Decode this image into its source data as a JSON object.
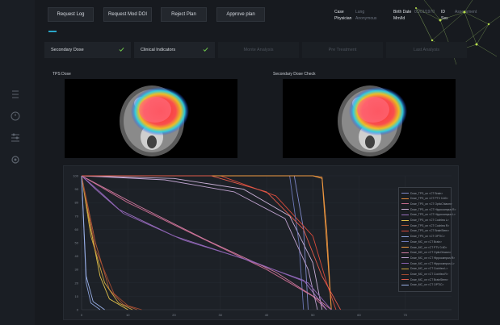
{
  "toolbar": {
    "request_log": "Request Log",
    "request_mod": "Request Mod DOI",
    "reject_plan": "Reject Plan",
    "approve_plan": "Approve plan"
  },
  "patient": {
    "case_label": "Case",
    "case_value": "Lung",
    "physician_label": "Physician",
    "physician_value": "Anonymous",
    "birth_label": "Birth Date",
    "birth_value": "01/01/1970",
    "mrn_label": "Mrn/Id",
    "mrn_value": "ID",
    "sex_label": "Sex",
    "status_value": "Assessment"
  },
  "steps": [
    {
      "label": "Secondary Dose",
      "done": true
    },
    {
      "label": "Clinical Indicators",
      "done": true
    },
    {
      "label": "Monte Analysis",
      "done": false
    },
    {
      "label": "Pre Treatment",
      "done": false
    },
    {
      "label": "Last Analysis",
      "done": false
    }
  ],
  "panels": {
    "tps_title": "TPS Dose",
    "secondary_title": "Secondary Dose Check"
  },
  "chart_data": {
    "type": "line",
    "xlim": [
      0,
      80
    ],
    "ylim": [
      0,
      100
    ],
    "x_ticks": [
      "0",
      "10",
      "20",
      "30",
      "40",
      "50",
      "60",
      "70"
    ],
    "y_ticks": [
      "0",
      "10",
      "20",
      "30",
      "40",
      "50",
      "60",
      "70",
      "80",
      "90",
      "100"
    ],
    "legend_position": "right",
    "series": [
      {
        "name": "Dose_TPS_on <CT Brain>",
        "color": "#7f88c8",
        "points": [
          [
            0,
            100
          ],
          [
            30,
            100
          ],
          [
            46,
            100
          ],
          [
            48,
            60
          ],
          [
            49,
            0
          ]
        ]
      },
      {
        "name": "Dose_TPS_on <CT PTV 0-60>",
        "color": "#e08a3c",
        "points": [
          [
            0,
            100
          ],
          [
            50,
            100
          ],
          [
            52,
            99
          ],
          [
            53,
            60
          ],
          [
            54,
            0
          ]
        ]
      },
      {
        "name": "Dose_TPS_on <CT OpticChiasm>",
        "color": "#c46a8e",
        "points": [
          [
            0,
            100
          ],
          [
            10,
            80
          ],
          [
            25,
            55
          ],
          [
            40,
            30
          ],
          [
            50,
            10
          ],
          [
            53,
            0
          ]
        ]
      },
      {
        "name": "Dose_TPS_on <CT Hippocampus R>",
        "color": "#c9b0d6",
        "points": [
          [
            0,
            100
          ],
          [
            20,
            98
          ],
          [
            35,
            90
          ],
          [
            45,
            70
          ],
          [
            50,
            35
          ],
          [
            52,
            0
          ]
        ]
      },
      {
        "name": "Dose_TPS_on <CT Hippocampus L>",
        "color": "#9a6fbf",
        "points": [
          [
            0,
            100
          ],
          [
            3,
            90
          ],
          [
            8,
            75
          ],
          [
            20,
            55
          ],
          [
            35,
            38
          ],
          [
            48,
            22
          ],
          [
            53,
            0
          ]
        ]
      },
      {
        "name": "Dose_TPS_on <CT Cochlea L>",
        "color": "#e0c04a",
        "points": [
          [
            0,
            100
          ],
          [
            2,
            60
          ],
          [
            4,
            25
          ],
          [
            6,
            8
          ],
          [
            10,
            0
          ]
        ]
      },
      {
        "name": "Dose_TPS_on <CT Cochlea R>",
        "color": "#b05a3a",
        "points": [
          [
            0,
            100
          ],
          [
            3,
            50
          ],
          [
            6,
            15
          ],
          [
            9,
            4
          ],
          [
            12,
            0
          ]
        ]
      },
      {
        "name": "Dose_TPS_on <CT BrainStem>",
        "color": "#d84a3a",
        "points": [
          [
            0,
            100
          ],
          [
            30,
            100
          ],
          [
            42,
            85
          ],
          [
            50,
            55
          ],
          [
            53,
            20
          ],
          [
            55,
            0
          ]
        ]
      },
      {
        "name": "Dose_TPS_on <CT OPTIC>",
        "color": "#8aa0d8",
        "points": [
          [
            0,
            100
          ],
          [
            1,
            20
          ],
          [
            2,
            5
          ],
          [
            4,
            0
          ]
        ]
      },
      {
        "name": "Dose_MC_on <CT Brain>",
        "color": "#6c78b8",
        "points": [
          [
            0,
            100
          ],
          [
            30,
            100
          ],
          [
            45,
            100
          ],
          [
            47,
            50
          ],
          [
            48,
            0
          ]
        ]
      },
      {
        "name": "Dose_MC_on <CT PTV 0-60>",
        "color": "#f09a40",
        "points": [
          [
            0,
            100
          ],
          [
            50,
            100
          ],
          [
            52,
            98
          ],
          [
            53,
            50
          ],
          [
            54,
            0
          ]
        ]
      },
      {
        "name": "Dose_MC_on <CT OpticChiasm>",
        "color": "#d07aa0",
        "points": [
          [
            0,
            100
          ],
          [
            12,
            78
          ],
          [
            27,
            52
          ],
          [
            42,
            28
          ],
          [
            51,
            8
          ],
          [
            54,
            0
          ]
        ]
      },
      {
        "name": "Dose_MC_on <CT Hippocampus R>",
        "color": "#bfa2cf",
        "points": [
          [
            0,
            100
          ],
          [
            18,
            97
          ],
          [
            33,
            88
          ],
          [
            44,
            68
          ],
          [
            49,
            30
          ],
          [
            51,
            0
          ]
        ]
      },
      {
        "name": "Dose_MC_on <CT Hippocampus L>",
        "color": "#8a60b0",
        "points": [
          [
            0,
            100
          ],
          [
            4,
            88
          ],
          [
            9,
            72
          ],
          [
            22,
            52
          ],
          [
            37,
            36
          ],
          [
            49,
            20
          ],
          [
            54,
            0
          ]
        ]
      },
      {
        "name": "Dose_MC_on <CT Cochlea L>",
        "color": "#d0a840",
        "points": [
          [
            0,
            100
          ],
          [
            2,
            55
          ],
          [
            5,
            20
          ],
          [
            8,
            5
          ],
          [
            11,
            0
          ]
        ]
      },
      {
        "name": "Dose_MC_on <CT Cochlea R>",
        "color": "#a04a30",
        "points": [
          [
            0,
            100
          ],
          [
            3,
            45
          ],
          [
            7,
            12
          ],
          [
            10,
            3
          ],
          [
            13,
            0
          ]
        ]
      },
      {
        "name": "Dose_MC_on <CT BrainStem>",
        "color": "#e05a4a",
        "points": [
          [
            0,
            100
          ],
          [
            28,
            100
          ],
          [
            40,
            88
          ],
          [
            48,
            60
          ],
          [
            52,
            25
          ],
          [
            56,
            0
          ]
        ]
      },
      {
        "name": "Dose_MC_on <CT OPTIC>",
        "color": "#9ab0e8",
        "points": [
          [
            0,
            100
          ],
          [
            1,
            25
          ],
          [
            2.5,
            6
          ],
          [
            5,
            0
          ]
        ]
      }
    ]
  }
}
